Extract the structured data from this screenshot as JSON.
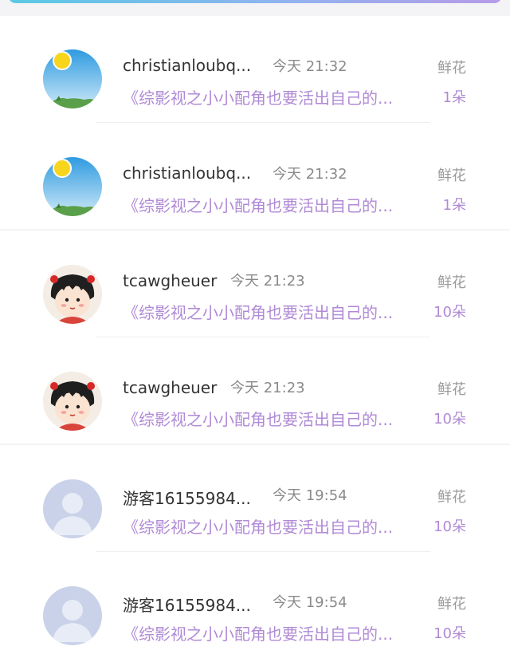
{
  "records": [
    {
      "name": "christianloubq...",
      "time": "今天 21:32",
      "gift": "鲜花",
      "book": "《综影视之小小配角也要活出自己的...",
      "count": "1朵",
      "avatar": "sky-avatar"
    },
    {
      "name": "christianloubq...",
      "time": "今天 21:32",
      "gift": "鲜花",
      "book": "《综影视之小小配角也要活出自己的...",
      "count": "1朵",
      "avatar": "sky-avatar"
    },
    {
      "name": "tcawgheuer",
      "time": "今天 21:23",
      "gift": "鲜花",
      "book": "《综影视之小小配角也要活出自己的...",
      "count": "10朵",
      "avatar": "cartoon-girl-avatar"
    },
    {
      "name": "tcawgheuer",
      "time": "今天 21:23",
      "gift": "鲜花",
      "book": "《综影视之小小配角也要活出自己的...",
      "count": "10朵",
      "avatar": "cartoon-girl-avatar"
    },
    {
      "name": "游客16155984...",
      "time": "今天 19:54",
      "gift": "鲜花",
      "book": "《综影视之小小配角也要活出自己的...",
      "count": "10朵",
      "avatar": "default-person-avatar"
    },
    {
      "name": "游客16155984...",
      "time": "今天 19:54",
      "gift": "鲜花",
      "book": "《综影视之小小配角也要活出自己的...",
      "count": "10朵",
      "avatar": "default-person-avatar"
    }
  ],
  "colors": {
    "accent": "#b08ad6",
    "header_gradient_start": "#59c9e4",
    "header_gradient_end": "#b79be8"
  }
}
